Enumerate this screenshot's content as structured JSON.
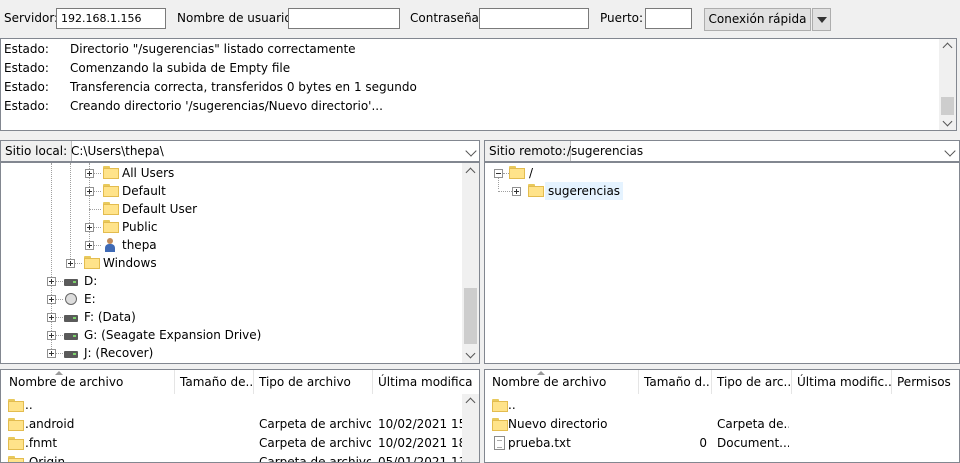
{
  "quickconnect": {
    "host_label": "Servidor:",
    "host_value": "192.168.1.156",
    "user_label": "Nombre de usuario:",
    "user_value": "",
    "pass_label": "Contraseña:",
    "pass_value": "",
    "port_label": "Puerto:",
    "port_value": "",
    "connect_label": "Conexión rápida"
  },
  "log": {
    "rows": [
      {
        "key": "Estado:",
        "msg": "Directorio \"/sugerencias\" listado correctamente"
      },
      {
        "key": "Estado:",
        "msg": "Comenzando la subida de Empty file"
      },
      {
        "key": "Estado:",
        "msg": "Transferencia correcta, transferidos 0 bytes en 1 segundo"
      },
      {
        "key": "Estado:",
        "msg": "Creando directorio '/sugerencias/Nuevo directorio'..."
      }
    ]
  },
  "local": {
    "label": "Sitio local:",
    "path": "C:\\Users\\thepa\\",
    "tree": [
      {
        "name": "All Users",
        "icon": "folder-icon"
      },
      {
        "name": "Default",
        "icon": "folder-icon"
      },
      {
        "name": "Default User",
        "icon": "folder-icon"
      },
      {
        "name": "Public",
        "icon": "folder-icon"
      },
      {
        "name": "thepa",
        "icon": "user-folder-icon"
      },
      {
        "name": "Windows",
        "icon": "folder-icon"
      },
      {
        "name": "D:",
        "icon": "drive-icon"
      },
      {
        "name": "E:",
        "icon": "cd-drive-icon"
      },
      {
        "name": "F: (Data)",
        "icon": "drive-icon"
      },
      {
        "name": "G: (Seagate Expansion Drive)",
        "icon": "drive-icon"
      },
      {
        "name": "J: (Recover)",
        "icon": "drive-icon"
      }
    ],
    "columns": [
      "Nombre de archivo",
      "Tamaño de...",
      "Tipo de archivo",
      "Última modifica"
    ],
    "files": [
      {
        "name": "..",
        "size": "",
        "type": "",
        "modified": ""
      },
      {
        "name": ".android",
        "size": "",
        "type": "Carpeta de archivos",
        "modified": "10/02/2021 15:3"
      },
      {
        "name": ".fnmt",
        "size": "",
        "type": "Carpeta de archivos",
        "modified": "10/02/2021 18:5"
      },
      {
        "name": ".Origin",
        "size": "",
        "type": "Carpeta de archivos",
        "modified": "05/01/2021 13:4"
      }
    ]
  },
  "remote": {
    "label": "Sitio remoto:",
    "path": "/sugerencias",
    "tree": [
      {
        "name": "/",
        "icon": "folder-icon"
      },
      {
        "name": "sugerencias",
        "icon": "folder-icon"
      }
    ],
    "columns": [
      "Nombre de archivo",
      "Tamaño d...",
      "Tipo de arc...",
      "Última modific...",
      "Permisos"
    ],
    "files": [
      {
        "name": "..",
        "size": "",
        "type": "",
        "modified": "",
        "perms": ""
      },
      {
        "name": "Nuevo directorio",
        "size": "",
        "type": "Carpeta de...",
        "modified": "",
        "perms": ""
      },
      {
        "name": "prueba.txt",
        "size": "0",
        "type": "Document...",
        "modified": "",
        "perms": ""
      }
    ]
  },
  "colors": {
    "selection": "#e5f3ff",
    "folder": "#ffe38a",
    "border": "#828790"
  }
}
